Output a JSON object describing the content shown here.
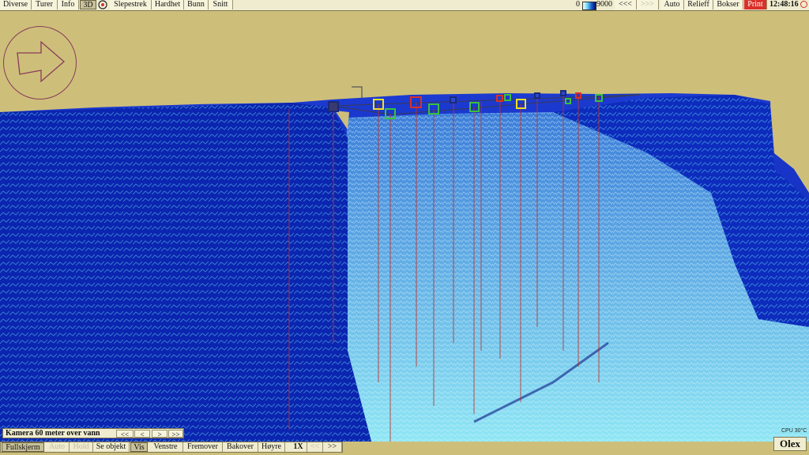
{
  "toolbar": {
    "left_buttons": [
      "Diverse",
      "Turer",
      "Info",
      "3D",
      "Slepestrek",
      "Hardhet",
      "Bunn",
      "Snitt"
    ],
    "scale_min": "0",
    "scale_max": "9000",
    "back_label": "<<<",
    "fwd_label": ">>>",
    "right_buttons": [
      "Auto",
      "Relieff",
      "Bokser",
      "Print"
    ],
    "time": "12:48:16"
  },
  "camera": {
    "text": "Kamera 60 meter over vann",
    "buttons": [
      "<<",
      "<",
      ">",
      ">>"
    ]
  },
  "bottom_bar": {
    "buttons": [
      "Fullskjerm",
      "Auto",
      "Hold",
      "Se objekt",
      "Vis",
      "Venstre",
      "Fremover",
      "Bakover",
      "Høyre",
      "1X",
      "<<",
      ">>"
    ]
  },
  "status": {
    "cpu": "CPU 30°C",
    "brand": "Olex"
  },
  "colors": {
    "sky": "#cdbf7a",
    "seafloor_deep": "#0a2ab8",
    "seafloor_shallow": "#7fe0f0",
    "marker_red": "#d9302a",
    "marker_yellow": "#f0e020",
    "marker_green": "#3ac040",
    "marker_navy": "#1a2a7a"
  },
  "icons": {
    "compass": "direction-arrow-icon",
    "target": "target-icon",
    "sun": "sun-icon"
  }
}
